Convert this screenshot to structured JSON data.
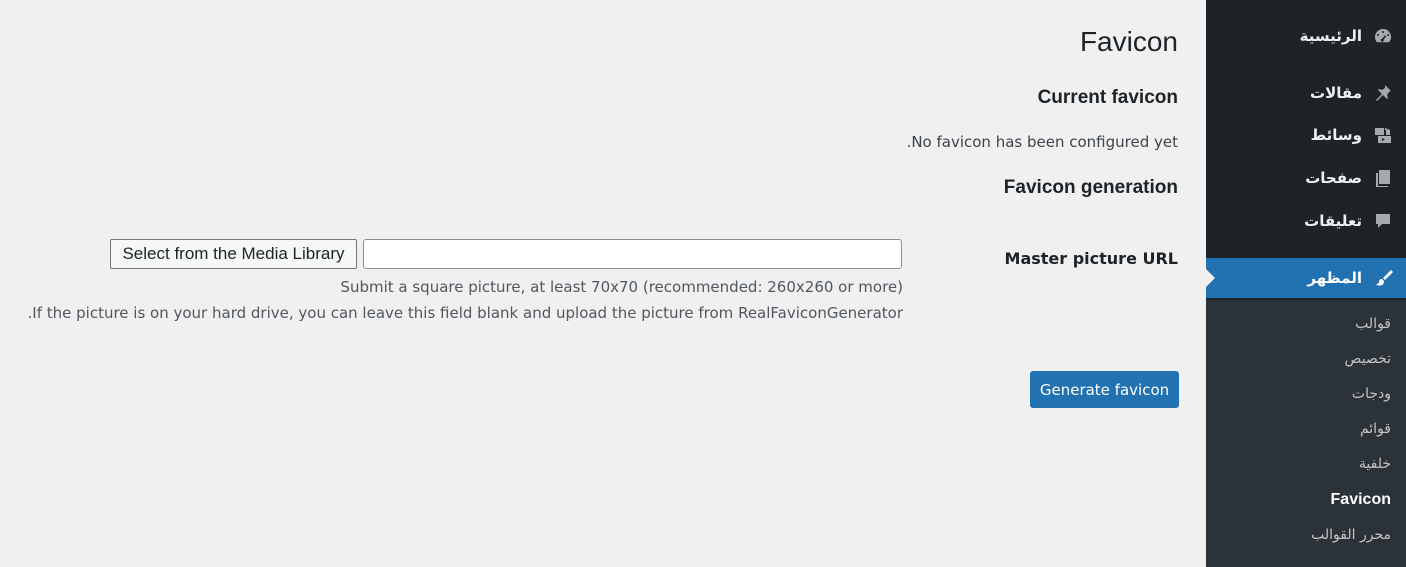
{
  "sidebar": {
    "items": [
      {
        "label": "الرئيسية",
        "icon": "dashboard-icon"
      },
      {
        "label": "مقالات",
        "icon": "pin-icon"
      },
      {
        "label": "وسائط",
        "icon": "media-icon"
      },
      {
        "label": "صفحات",
        "icon": "pages-icon"
      },
      {
        "label": "تعليقات",
        "icon": "comments-icon"
      },
      {
        "label": "المظهر",
        "icon": "appearance-brush-icon"
      }
    ],
    "submenu": [
      {
        "label": "قوالب"
      },
      {
        "label": "تخصيص"
      },
      {
        "label": "ودجات"
      },
      {
        "label": "قوائم"
      },
      {
        "label": "خلفية"
      },
      {
        "label": "Favicon"
      },
      {
        "label": "محرر القوالب"
      }
    ],
    "colors": {
      "background": "#1d2327",
      "submenu_background": "#2c3338",
      "accent": "#2271b1"
    }
  },
  "main": {
    "title": "Favicon",
    "current_heading": "Current favicon",
    "no_favicon_text": "No favicon has been configured yet.",
    "generation_heading": "Favicon generation",
    "master_label": "Master picture URL",
    "url_value": "",
    "media_button_label": "Select from the Media Library",
    "help_line_1": "Submit a square picture, at least 70x70 (recommended: 260x260 or more)",
    "help_line_2": "If the picture is on your hard drive, you can leave this field blank and upload the picture from RealFaviconGenerator.",
    "generate_button_label": "Generate favicon"
  }
}
